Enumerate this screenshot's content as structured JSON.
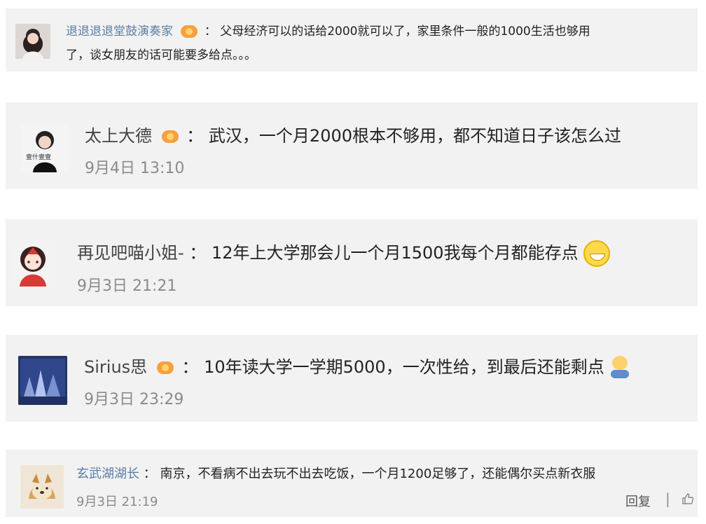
{
  "comments": [
    {
      "name": "退退退退堂鼓演奏家",
      "separator": "：",
      "text_line_1": "父母经济可以的话给2000就可以了，家里条件一般的1000生活也够用",
      "text_line_2": "了，谈女朋友的话可能要多给点。。。",
      "avatar_icon": "user-avatar-icon"
    },
    {
      "name": "太上大德",
      "separator": "：",
      "text": "武汉，一个月2000根本不够用，都不知道日子该怎么过",
      "time": "9月4日 13:10",
      "avatar_label": "壹什壹壹",
      "avatar_icon": "user-avatar-icon"
    },
    {
      "name": "再见吧喵小姐-",
      "separator": "：",
      "text": "12年上大学那会儿一个月1500我每个月都能存点",
      "time": "9月3日 21:21",
      "avatar_icon": "user-avatar-icon",
      "emoji": "laugh-emoji-icon"
    },
    {
      "name": "Sirius思",
      "separator": "：",
      "text": "10年读大学一学期5000，一次性给，到最后还能剩点",
      "time": "9月3日 23:29",
      "avatar_icon": "user-avatar-icon",
      "emoji": "cry-emoji-icon"
    },
    {
      "name": "玄武湖湖长",
      "separator": "：",
      "text": "南京，不看病不出去玩不出去吃饭，一个月1200足够了，还能偶尔买点新衣服",
      "time": "9月3日 21:19",
      "reply_label": "回复",
      "separator_bar": "|",
      "avatar_icon": "user-avatar-icon",
      "like_icon": "thumbs-up-icon"
    }
  ],
  "colors": {
    "card_background": "#f2f2f2",
    "name": "#5b7fa6",
    "text": "#222222",
    "meta": "#8b8b8b"
  }
}
